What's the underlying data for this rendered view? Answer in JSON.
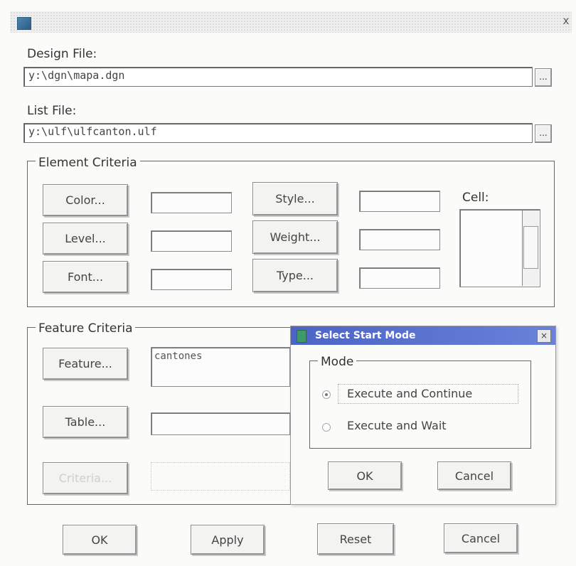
{
  "window": {
    "close_glyph": "x"
  },
  "design_file": {
    "label": "Design File:",
    "value": "y:\\dgn\\mapa.dgn",
    "browse": "..."
  },
  "list_file": {
    "label": "List File:",
    "value": "y:\\ulf\\ulfcanton.ulf",
    "browse": "..."
  },
  "element_criteria": {
    "title": "Element Criteria",
    "color_btn": "Color...",
    "level_btn": "Level...",
    "font_btn": "Font...",
    "style_btn": "Style...",
    "weight_btn": "Weight...",
    "type_btn": "Type...",
    "cell_label": "Cell:"
  },
  "feature_criteria": {
    "title": "Feature Criteria",
    "feature_btn": "Feature...",
    "feature_value": "cantones",
    "table_btn": "Table...",
    "disabled_btn": "Criteria..."
  },
  "start_mode_dialog": {
    "title": "Select Start Mode",
    "close_glyph": "×",
    "mode_title": "Mode",
    "options": [
      "Execute and Continue",
      "Execute and Wait"
    ],
    "selected_index": 0,
    "ok": "OK",
    "cancel": "Cancel"
  },
  "footer": {
    "ok": "OK",
    "apply": "Apply",
    "reset": "Reset",
    "cancel": "Cancel"
  }
}
